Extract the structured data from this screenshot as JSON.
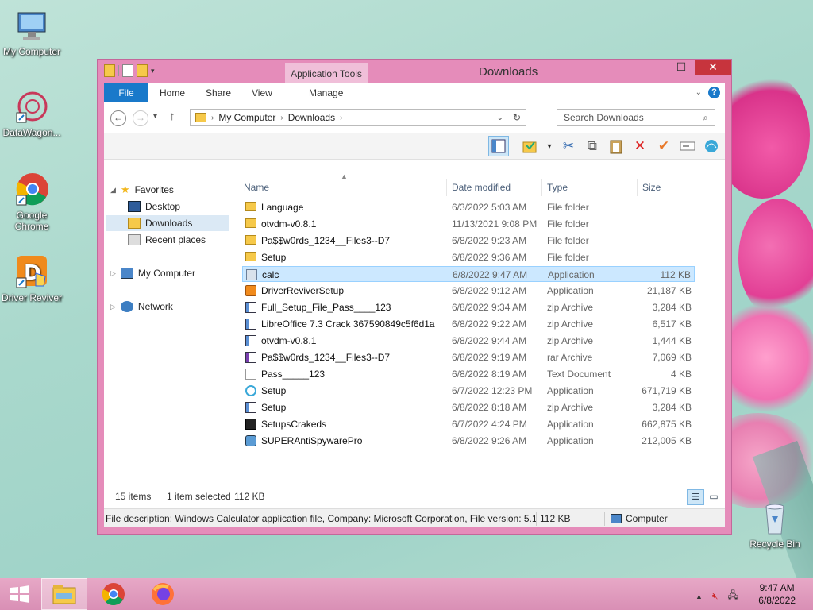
{
  "desktop": {
    "icons": [
      {
        "label": "My Computer"
      },
      {
        "label": "DataWagon..."
      },
      {
        "label": "Google Chrome"
      },
      {
        "label": "Driver Reviver"
      },
      {
        "label": "Recycle Bin"
      }
    ]
  },
  "window": {
    "title": "Downloads",
    "context_tab": "Application Tools",
    "ribbon_tabs": [
      "File",
      "Home",
      "Share",
      "View",
      "Manage"
    ],
    "help": "?",
    "breadcrumb": [
      "My Computer",
      "Downloads"
    ],
    "search_placeholder": "Search Downloads"
  },
  "navpane": {
    "favorites": "Favorites",
    "items": [
      "Desktop",
      "Downloads",
      "Recent places"
    ],
    "computer": "My Computer",
    "network": "Network"
  },
  "columns": [
    "Name",
    "Date modified",
    "Type",
    "Size"
  ],
  "files": [
    {
      "name": "Language",
      "date": "6/3/2022 5:03 AM",
      "type": "File folder",
      "size": "",
      "icon": "folder"
    },
    {
      "name": "otvdm-v0.8.1",
      "date": "11/13/2021 9:08 PM",
      "type": "File folder",
      "size": "",
      "icon": "folder"
    },
    {
      "name": "Pa$$w0rds_1234__Files3--D7",
      "date": "6/8/2022 9:23 AM",
      "type": "File folder",
      "size": "",
      "icon": "folder"
    },
    {
      "name": "Setup",
      "date": "6/8/2022 9:36 AM",
      "type": "File folder",
      "size": "",
      "icon": "folder"
    },
    {
      "name": "calc",
      "date": "6/8/2022 9:47 AM",
      "type": "Application",
      "size": "112 KB",
      "icon": "app"
    },
    {
      "name": "DriverReviverSetup",
      "date": "6/8/2022 9:12 AM",
      "type": "Application",
      "size": "21,187 KB",
      "icon": "setup"
    },
    {
      "name": "Full_Setup_File_Pass____123",
      "date": "6/8/2022 9:34 AM",
      "type": "zip Archive",
      "size": "3,284 KB",
      "icon": "zip"
    },
    {
      "name": "LibreOffice 7.3 Crack 367590849c5f6d1a",
      "date": "6/8/2022 9:22 AM",
      "type": "zip Archive",
      "size": "6,517 KB",
      "icon": "zip"
    },
    {
      "name": "otvdm-v0.8.1",
      "date": "6/8/2022 9:44 AM",
      "type": "zip Archive",
      "size": "1,444 KB",
      "icon": "zip"
    },
    {
      "name": "Pa$$w0rds_1234__Files3--D7",
      "date": "6/8/2022 9:19 AM",
      "type": "rar Archive",
      "size": "7,069 KB",
      "icon": "rar"
    },
    {
      "name": "Pass_____123",
      "date": "6/8/2022 8:19 AM",
      "type": "Text Document",
      "size": "4 KB",
      "icon": "txt"
    },
    {
      "name": "Setup",
      "date": "6/7/2022 12:23 PM",
      "type": "Application",
      "size": "671,719 KB",
      "icon": "circle"
    },
    {
      "name": "Setup",
      "date": "6/8/2022 8:18 AM",
      "type": "zip Archive",
      "size": "3,284 KB",
      "icon": "zip"
    },
    {
      "name": "SetupsCrakeds",
      "date": "6/7/2022 4:24 PM",
      "type": "Application",
      "size": "662,875 KB",
      "icon": "dark"
    },
    {
      "name": "SUPERAntiSpywarePro",
      "date": "6/8/2022 9:26 AM",
      "type": "Application",
      "size": "212,005 KB",
      "icon": "super"
    }
  ],
  "status": {
    "count": "15 items",
    "selected": "1 item selected",
    "selected_size": "112 KB"
  },
  "description": {
    "text": "File description: Windows Calculator application file, Company: Microsoft Corporation, File version: 5.1",
    "size": "112 KB",
    "location": "Computer"
  },
  "taskbar": {
    "time": "9:47 AM",
    "date": "6/8/2022"
  },
  "colors": {
    "accent": "#1979ca",
    "frame": "#e58cba",
    "close": "#c7343d",
    "selection": "#cce8ff"
  }
}
